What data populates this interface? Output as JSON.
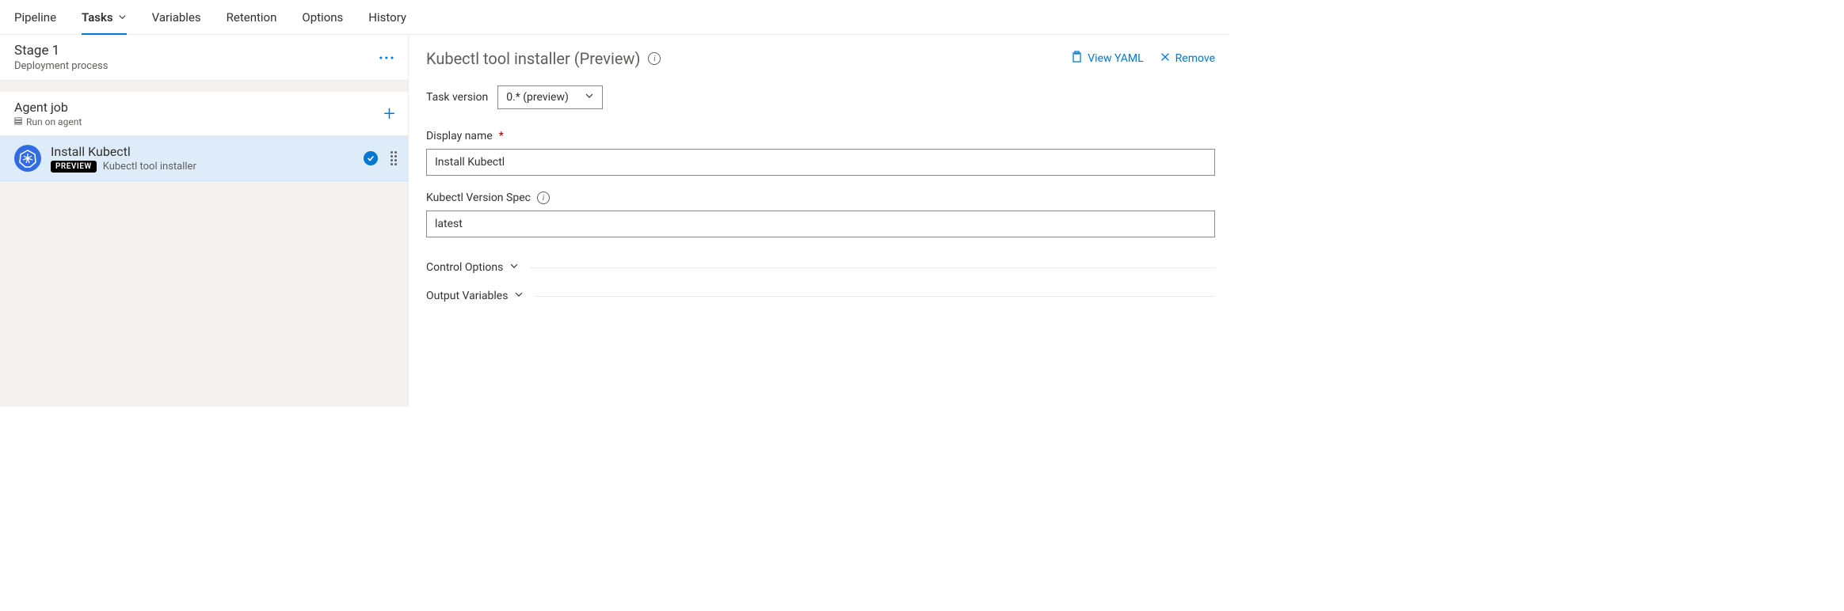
{
  "tabs": {
    "pipeline": "Pipeline",
    "tasks": "Tasks",
    "variables": "Variables",
    "retention": "Retention",
    "options": "Options",
    "history": "History"
  },
  "stage": {
    "title": "Stage 1",
    "subtitle": "Deployment process"
  },
  "agentJob": {
    "title": "Agent job",
    "subtitle": "Run on agent"
  },
  "task": {
    "title": "Install Kubectl",
    "badge": "PREVIEW",
    "desc": "Kubectl tool installer"
  },
  "detail": {
    "title": "Kubectl tool installer (Preview)",
    "viewYaml": "View YAML",
    "remove": "Remove",
    "taskVersionLabel": "Task version",
    "taskVersionValue": "0.* (preview)",
    "displayNameLabel": "Display name",
    "displayNameValue": "Install Kubectl",
    "versionSpecLabel": "Kubectl Version Spec",
    "versionSpecValue": "latest",
    "controlOptions": "Control Options",
    "outputVariables": "Output Variables"
  }
}
